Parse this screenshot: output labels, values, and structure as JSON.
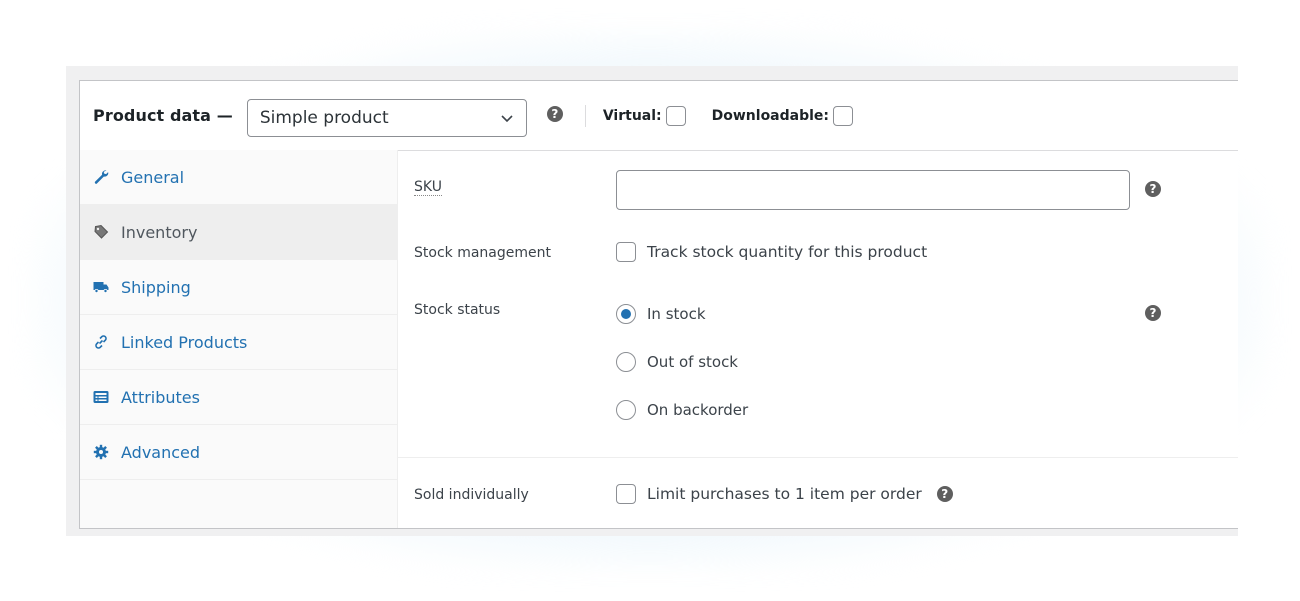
{
  "header": {
    "title": "Product data —",
    "product_type": "Simple product",
    "virtual_label": "Virtual:",
    "virtual_checked": false,
    "downloadable_label": "Downloadable:",
    "downloadable_checked": false,
    "help_glyph": "?"
  },
  "tabs": [
    {
      "label": "General",
      "icon": "wrench-icon",
      "active": false
    },
    {
      "label": "Inventory",
      "icon": "tag-icon",
      "active": true
    },
    {
      "label": "Shipping",
      "icon": "truck-icon",
      "active": false
    },
    {
      "label": "Linked Products",
      "icon": "link-icon",
      "active": false
    },
    {
      "label": "Attributes",
      "icon": "list-icon",
      "active": false
    },
    {
      "label": "Advanced",
      "icon": "gear-icon",
      "active": false
    }
  ],
  "inventory": {
    "sku": {
      "label": "SKU",
      "value": ""
    },
    "stock_management": {
      "label": "Stock management",
      "option": "Track stock quantity for this product",
      "checked": false
    },
    "stock_status": {
      "label": "Stock status",
      "options": [
        {
          "label": "In stock",
          "checked": true
        },
        {
          "label": "Out of stock",
          "checked": false
        },
        {
          "label": "On backorder",
          "checked": false
        }
      ]
    },
    "sold_individually": {
      "label": "Sold individually",
      "option": "Limit purchases to 1 item per order",
      "checked": false
    }
  },
  "colors": {
    "accent": "#2271b1",
    "tab_active_bg": "#eeeeee",
    "frame_bg": "#f0f0f1"
  }
}
